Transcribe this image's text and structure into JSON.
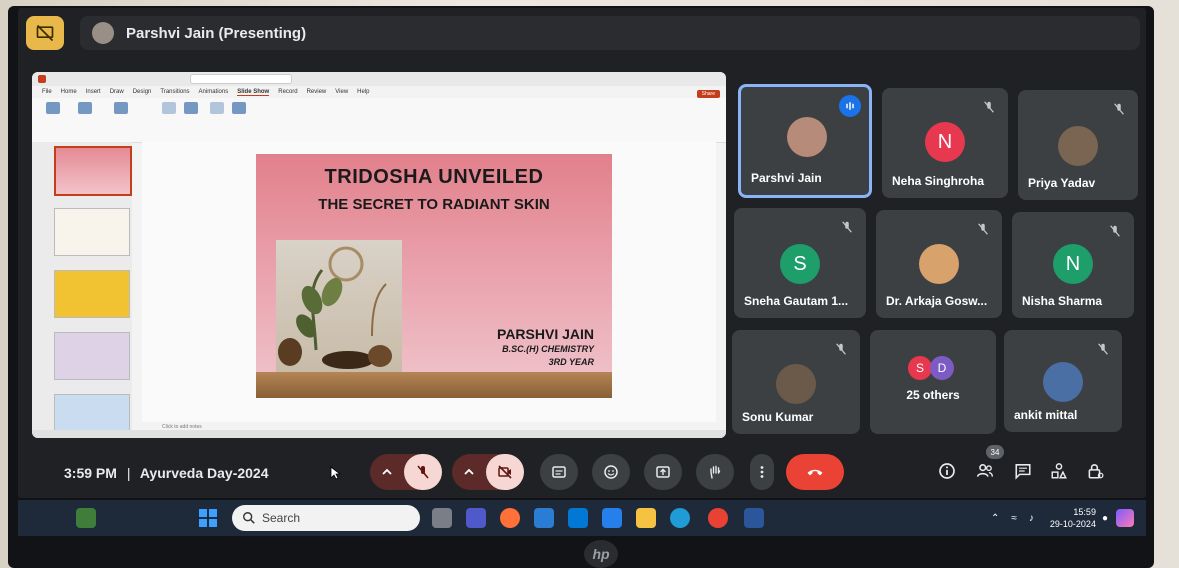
{
  "presenter_bar": {
    "name": "Parshvi Jain (Presenting)"
  },
  "ppt": {
    "menu": [
      "File",
      "Home",
      "Insert",
      "Draw",
      "Design",
      "Transitions",
      "Animations",
      "Slide Show",
      "Record",
      "Review",
      "View",
      "Help"
    ],
    "active_menu": "Slide Show",
    "share_label": "Share",
    "notes_placeholder": "Click to add notes"
  },
  "slide": {
    "title": "TRIDOSHA UNVEILED",
    "subtitle": "THE SECRET TO RADIANT SKIN",
    "author": "PARSHVI JAIN",
    "course": "B.SC.(H) CHEMISTRY",
    "year": "3RD YEAR"
  },
  "participants": [
    {
      "name": "Parshvi Jain",
      "type": "photo",
      "speaking": true,
      "muted": false
    },
    {
      "name": "Neha Singhroha",
      "initial": "N",
      "color": "#e8384f",
      "muted": true
    },
    {
      "name": "Priya Yadav",
      "type": "photo",
      "muted": true
    },
    {
      "name": "Sneha Gautam 1...",
      "initial": "S",
      "color": "#1e9e6a",
      "muted": true
    },
    {
      "name": "Dr. Arkaja Gosw...",
      "type": "photo",
      "muted": true
    },
    {
      "name": "Nisha Sharma",
      "initial": "N",
      "color": "#1e9e6a",
      "muted": true
    },
    {
      "name": "Sonu Kumar",
      "type": "photo",
      "muted": true
    },
    {
      "name": "25 others",
      "type": "group",
      "initials": [
        "S",
        "D"
      ]
    },
    {
      "name": "ankit mittal",
      "type": "photo",
      "muted": true
    }
  ],
  "meeting": {
    "time": "3:59 PM",
    "separator": "|",
    "title": "Ayurveda Day-2024",
    "participant_count": "34"
  },
  "taskbar": {
    "search_placeholder": "Search",
    "time": "15:59",
    "date": "29-10-2024"
  },
  "brand": {
    "hp": "hp"
  },
  "colors": {
    "speaking_border": "#8ab4f8",
    "end_call": "#ea4335",
    "present_icon": "#e8b84a"
  }
}
